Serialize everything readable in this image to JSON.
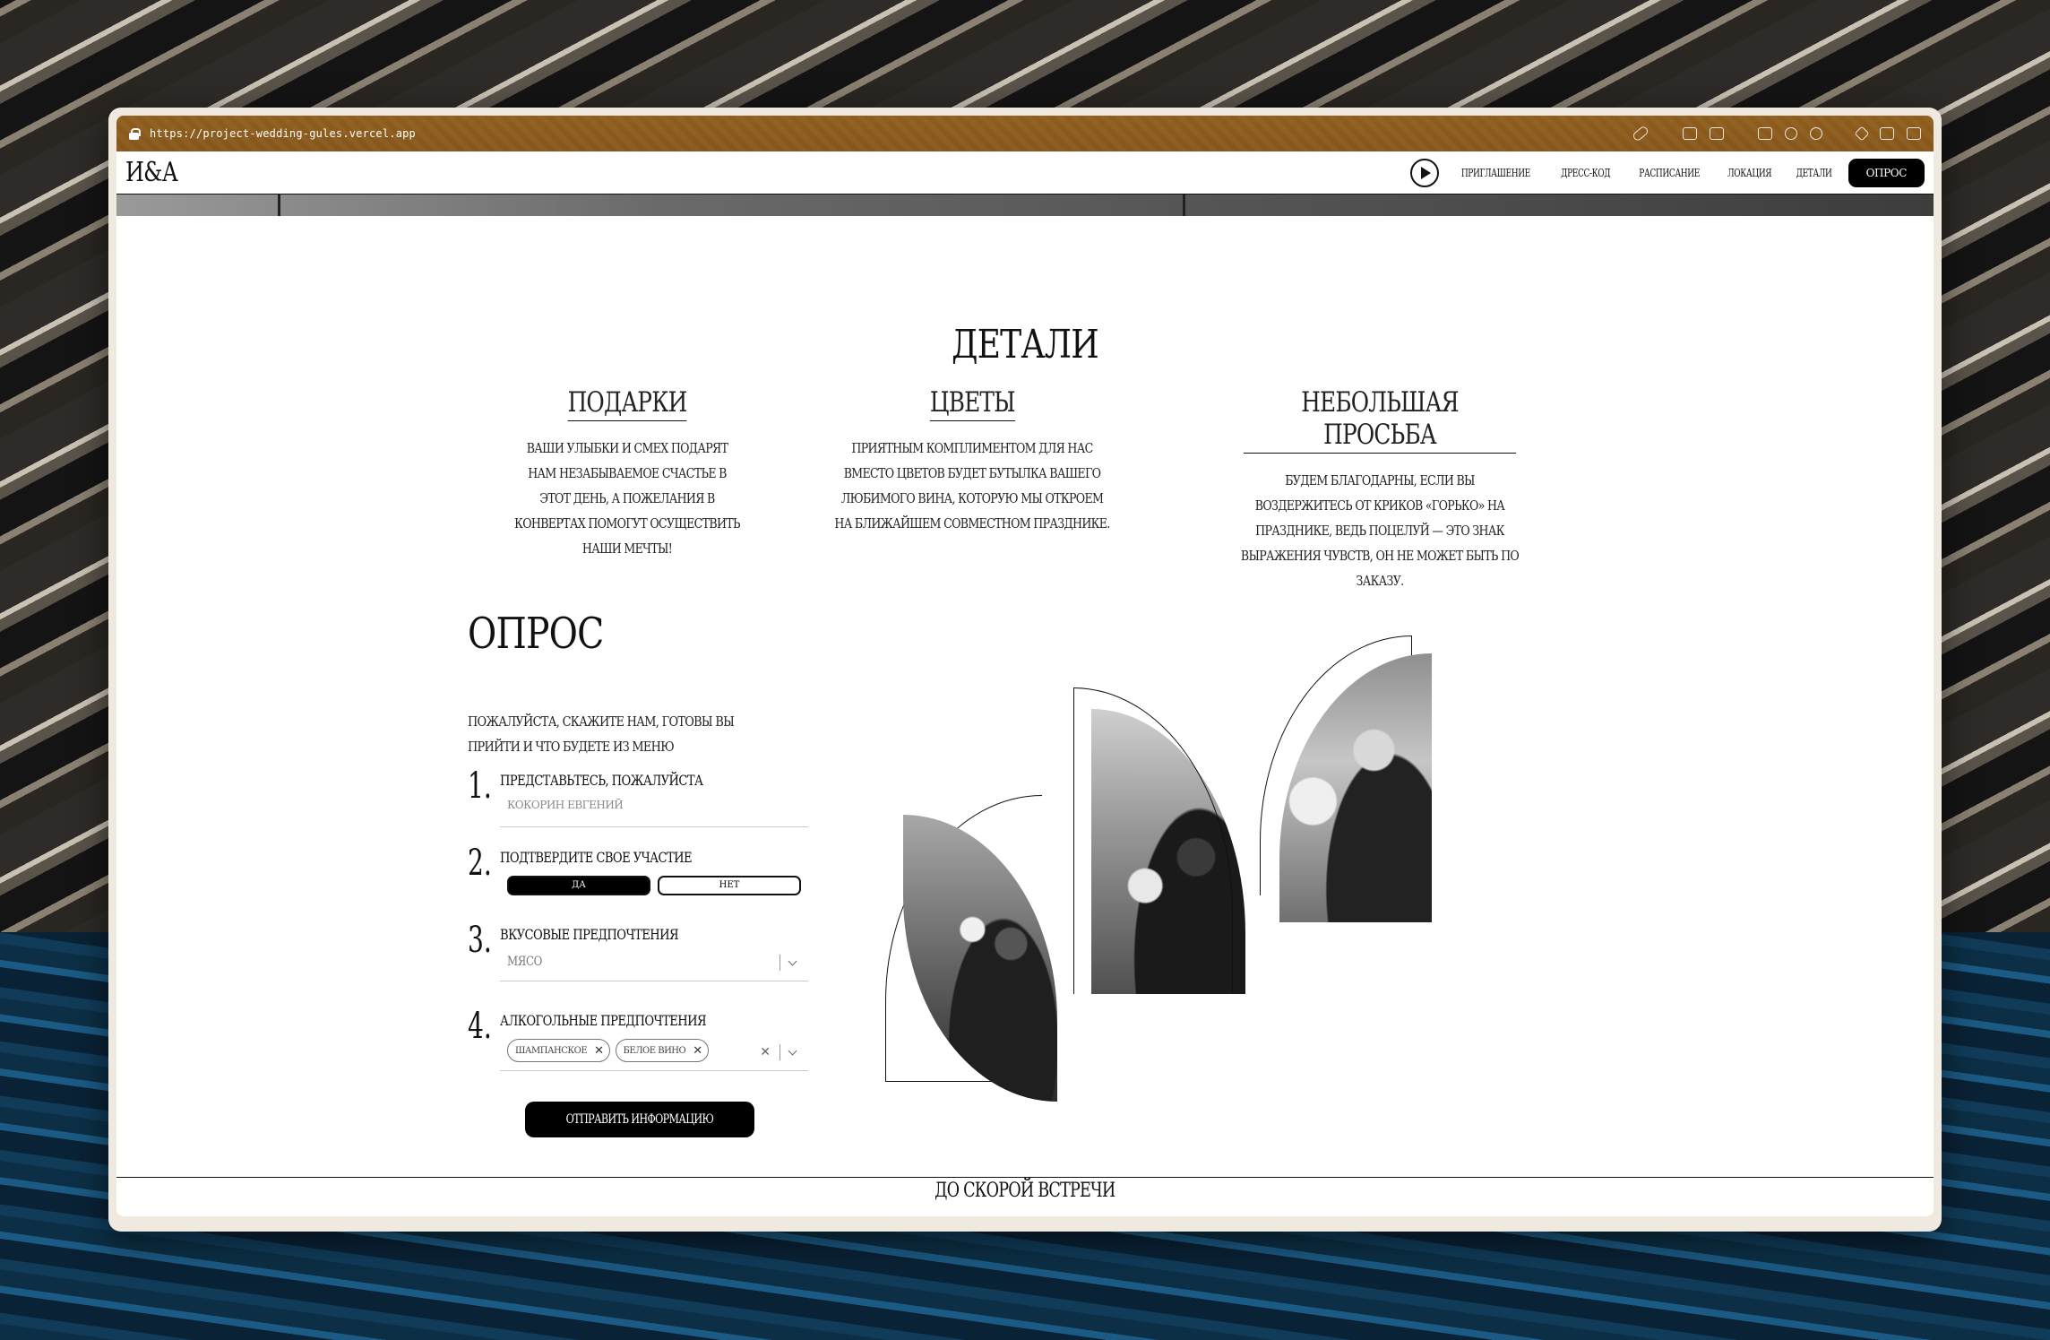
{
  "browser": {
    "url": "https://project-wedding-gules.vercel.app",
    "icons": [
      "link-icon",
      "screenshot-icon",
      "camera-icon",
      "terminal-icon",
      "globe-icon",
      "crosshair-icon",
      "code-icon",
      "picture-in-picture-icon",
      "split-view-icon"
    ],
    "titlebar_color": "#8b5a1b"
  },
  "header": {
    "logo": "И&А",
    "nav": [
      "ПРИГЛАШЕНИЕ",
      "ДРЕСС-КОД",
      "РАСПИСАНИЕ",
      "ЛОКАЦИЯ",
      "ДЕТАЛИ"
    ],
    "cta": "ОПРОС"
  },
  "details": {
    "title": "ДЕТАЛИ",
    "columns": [
      {
        "title": "ПОДАРКИ",
        "text": "ВАШИ УЛЫБКИ И СМЕХ ПОДАРЯТ НАМ НЕЗАБЫВАЕМОЕ СЧАСТЬЕ В ЭТОТ ДЕНЬ, А ПОЖЕЛАНИЯ В КОНВЕРТАХ ПОМОГУТ ОСУЩЕСТВИТЬ НАШИ МЕЧТЫ!"
      },
      {
        "title": "ЦВЕТЫ",
        "text": "ПРИЯТНЫМ КОМПЛИМЕНТОМ ДЛЯ НАС ВМЕСТО ЦВЕТОВ БУДЕТ БУТЫЛКА ВАШЕГО ЛЮБИМОГО ВИНА, КОТОРУЮ МЫ ОТКРОЕМ НА БЛИЖАЙШЕМ СОВМЕСТНОМ ПРАЗДНИКЕ."
      },
      {
        "title": "НЕБОЛЬШАЯ ПРОСЬБА",
        "text": "БУДЕМ БЛАГОДАРНЫ, ЕСЛИ ВЫ ВОЗДЕРЖИТЕСЬ ОТ КРИКОВ «ГОРЬКО» НА ПРАЗДНИКЕ, ВЕДЬ ПОЦЕЛУЙ — ЭТО ЗНАК ВЫРАЖЕНИЯ ЧУВСТВ, ОН НЕ МОЖЕТ БЫТЬ ПО ЗАКАЗУ."
      }
    ]
  },
  "survey": {
    "title": "ОПРОС",
    "intro": "ПОЖАЛУЙСТА, СКАЖИТЕ НАМ, ГОТОВЫ ВЫ ПРИЙТИ И ЧТО БУДЕТЕ ИЗ МЕНЮ",
    "questions": [
      {
        "num": "1.",
        "label": "ПРЕДСТАВЬТЕСЬ, ПОЖАЛУЙСТА",
        "placeholder": "КОКОРИН ЕВГЕНИЙ"
      },
      {
        "num": "2.",
        "label": "ПОДТВЕРДИТЕ СВОЕ УЧАСТИЕ",
        "options": [
          "ДА",
          "НЕТ"
        ],
        "selected": "ДА"
      },
      {
        "num": "3.",
        "label": "ВКУСОВЫЕ ПРЕДПОЧТЕНИЯ",
        "value": "МЯСО"
      },
      {
        "num": "4.",
        "label": "АЛКОГОЛЬНЫЕ ПРЕДПОЧТЕНИЯ",
        "chips": [
          "ШАМПАНСКОЕ",
          "БЕЛОЕ ВИНО"
        ]
      }
    ],
    "submit": "ОТПРАВИТЬ ИНФОРМАЦИЮ"
  },
  "footer": {
    "text": "ДО СКОРОЙ ВСТРЕЧИ"
  }
}
